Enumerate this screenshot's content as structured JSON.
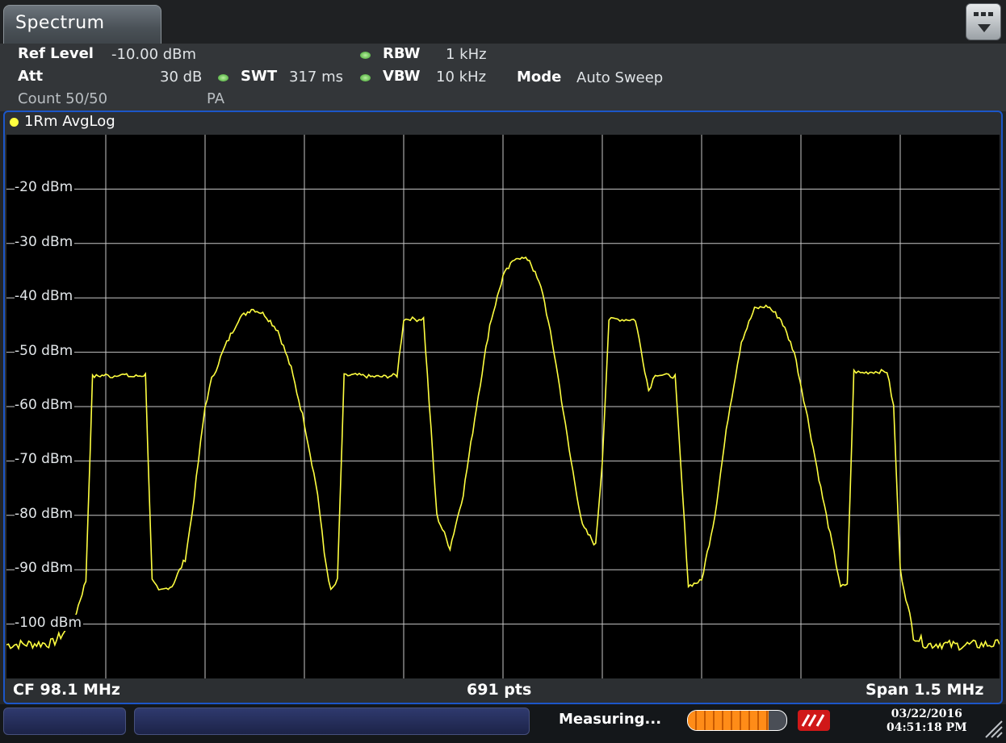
{
  "tab": {
    "title": "Spectrum"
  },
  "header": {
    "ref_level_label": "Ref Level",
    "ref_level_value": "-10.00 dBm",
    "att_label": "Att",
    "att_value": "30 dB",
    "swt_label": "SWT",
    "swt_value": "317 ms",
    "rbw_label": "RBW",
    "rbw_value": "1 kHz",
    "vbw_label": "VBW",
    "vbw_value": "10 kHz",
    "mode_label": "Mode",
    "mode_value": "Auto Sweep",
    "count_text": "Count 50/50",
    "preamp_text": "PA"
  },
  "trace": {
    "label": "1Rm AvgLog",
    "color": "#ffff40"
  },
  "footer": {
    "cf": "CF 98.1 MHz",
    "pts": "691 pts",
    "span": "Span 1.5 MHz"
  },
  "status": {
    "measuring": "Measuring...",
    "progress": 0.82,
    "date": "03/22/2016",
    "time": "04:51:18 PM"
  },
  "chart_data": {
    "type": "line",
    "x_range": [
      97.35,
      98.85
    ],
    "x_unit": "MHz",
    "ylim": [
      -110,
      -10
    ],
    "y_ticks": [
      -20,
      -30,
      -40,
      -50,
      -60,
      -70,
      -80,
      -90,
      -100
    ],
    "y_tick_labels": [
      "-20 dBm",
      "-30 dBm",
      "-40 dBm",
      "-50 dBm",
      "-60 dBm",
      "-70 dBm",
      "-80 dBm",
      "-90 dBm",
      "-100 dBm"
    ],
    "grid": true,
    "series": [
      {
        "x": [
          97.35,
          97.42,
          97.45,
          97.47,
          97.48,
          97.5,
          97.51,
          97.52,
          97.54,
          97.56,
          97.57,
          97.58,
          97.6,
          97.62,
          97.63,
          97.64,
          97.65,
          97.66,
          97.67,
          97.68,
          97.7,
          97.72,
          97.74,
          97.76,
          97.78,
          97.8,
          97.82,
          97.83,
          97.84,
          97.85,
          97.86,
          97.88,
          97.9,
          97.92,
          97.94,
          97.95,
          97.96,
          97.97,
          97.98,
          98.0,
          98.02,
          98.04,
          98.06,
          98.08,
          98.1,
          98.12,
          98.14,
          98.16,
          98.18,
          98.2,
          98.22,
          98.24,
          98.25,
          98.26,
          98.27,
          98.28,
          98.3,
          98.32,
          98.33,
          98.34,
          98.35,
          98.36,
          98.38,
          98.4,
          98.42,
          98.44,
          98.46,
          98.48,
          98.5,
          98.52,
          98.54,
          98.56,
          98.58,
          98.6,
          98.61,
          98.62,
          98.63,
          98.64,
          98.66,
          98.68,
          98.69,
          98.7,
          98.72,
          98.74,
          98.76,
          98.78,
          98.85
        ],
        "y": [
          -103.8,
          -103.5,
          -100,
          -92,
          -54.5,
          -54.2,
          -54.5,
          -54,
          -54.5,
          -54.2,
          -92,
          -94,
          -93,
          -88,
          -80,
          -70,
          -60,
          -55,
          -52,
          -49,
          -44,
          -42,
          -43,
          -46,
          -53,
          -63,
          -76,
          -87,
          -94,
          -92,
          -54.3,
          -54.2,
          -54.5,
          -54.5,
          -54.2,
          -44,
          -43.8,
          -44,
          -43.8,
          -80,
          -86,
          -76,
          -60,
          -45,
          -36,
          -32.5,
          -33,
          -39,
          -52,
          -68,
          -82,
          -85.5,
          -70,
          -44,
          -43.9,
          -44,
          -44,
          -57,
          -54,
          -54.2,
          -54.3,
          -54.5,
          -93,
          -92,
          -80,
          -62,
          -48,
          -42,
          -41.5,
          -44,
          -50,
          -62,
          -75,
          -87,
          -93,
          -93,
          -53.5,
          -53.8,
          -53.6,
          -53.5,
          -60,
          -90,
          -102,
          -103.8,
          -103.6,
          -103.9,
          -103.7
        ]
      }
    ]
  }
}
